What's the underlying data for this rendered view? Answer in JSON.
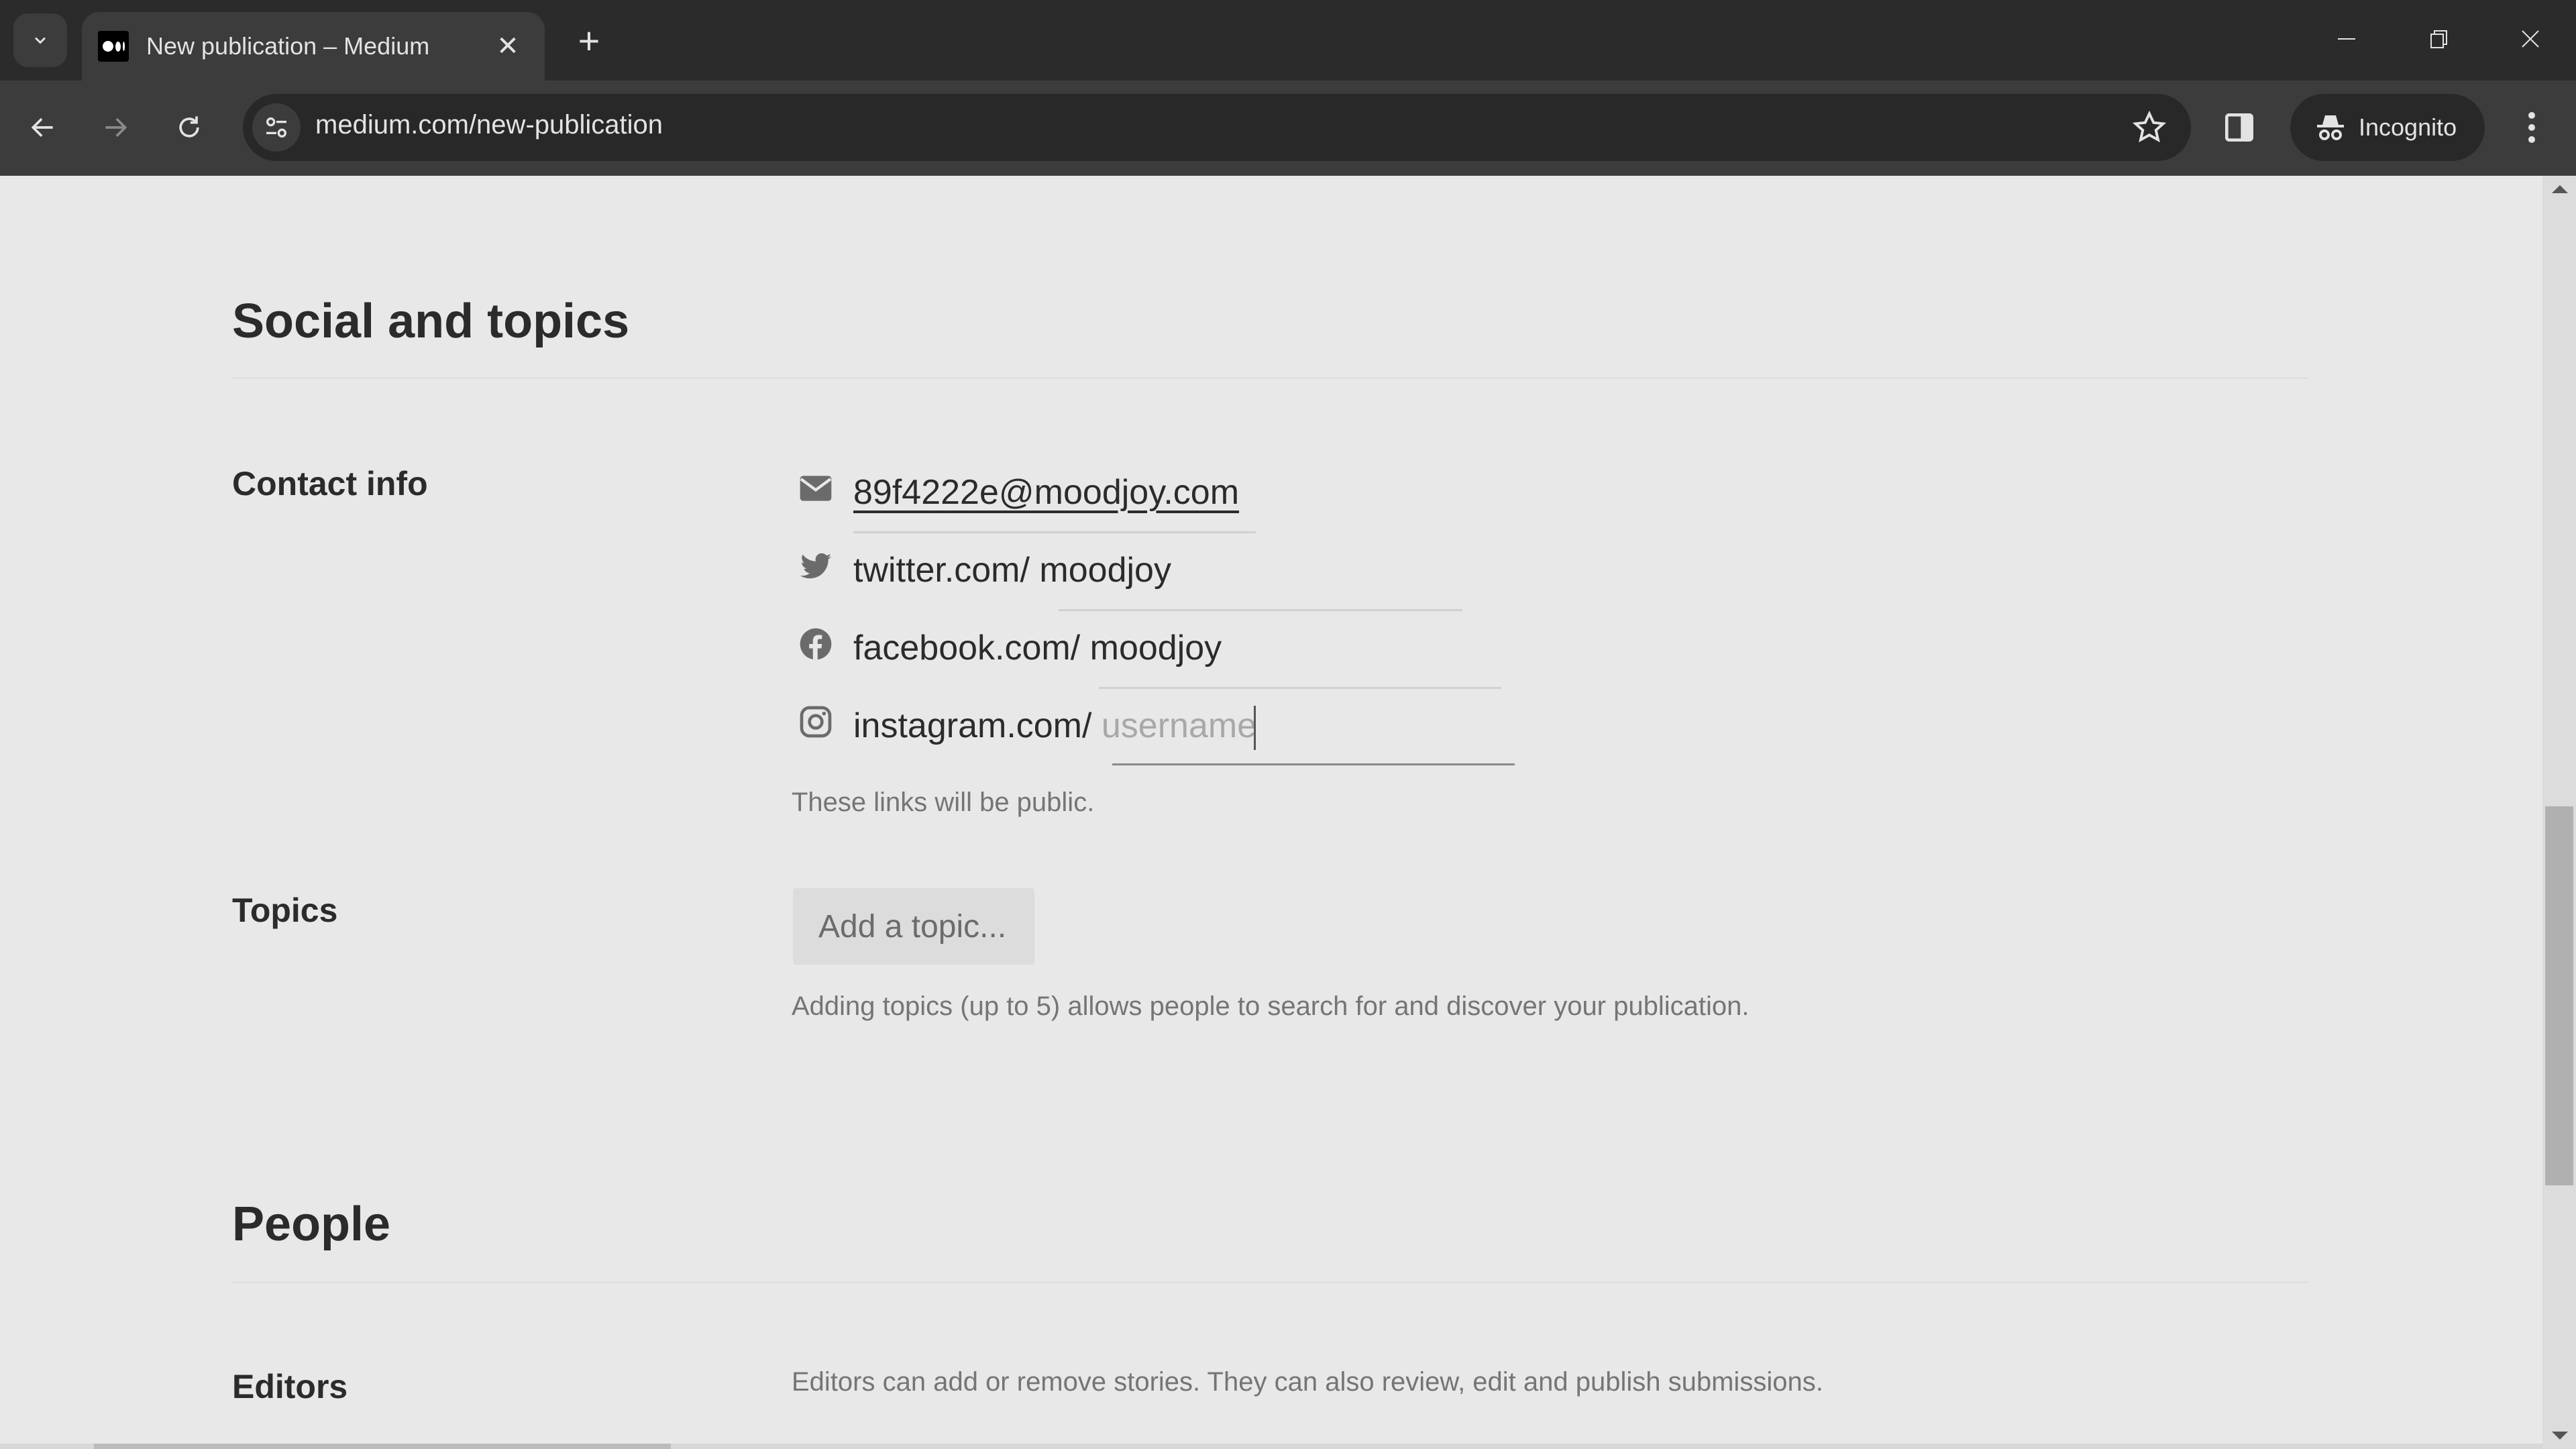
{
  "browser": {
    "tab_title": "New publication – Medium",
    "url": "medium.com/new-publication",
    "incognito_label": "Incognito"
  },
  "page": {
    "social_section": {
      "title": "Social and topics",
      "contact_label": "Contact info",
      "contacts": [
        {
          "icon": "mail-icon",
          "prefix": "",
          "value": "89f4222e@moodjoy.com",
          "placeholder": ""
        },
        {
          "icon": "twitter-icon",
          "prefix": "twitter.com/ ",
          "value": "moodjoy",
          "placeholder": "username"
        },
        {
          "icon": "facebook-icon",
          "prefix": "facebook.com/ ",
          "value": "moodjoy",
          "placeholder": "username"
        },
        {
          "icon": "instagram-icon",
          "prefix": "instagram.com/ ",
          "value": "",
          "placeholder": "username"
        }
      ],
      "contact_hint": "These links will be public.",
      "topics_label": "Topics",
      "topic_button": "Add a topic...",
      "topics_hint": "Adding topics (up to 5) allows people to search for and discover your publication."
    },
    "people_section": {
      "title": "People",
      "editors_label": "Editors",
      "editors_hint": "Editors can add or remove stories. They can also review, edit and publish submissions."
    }
  },
  "scroll": {
    "vertical_position_fraction": 0.56
  }
}
